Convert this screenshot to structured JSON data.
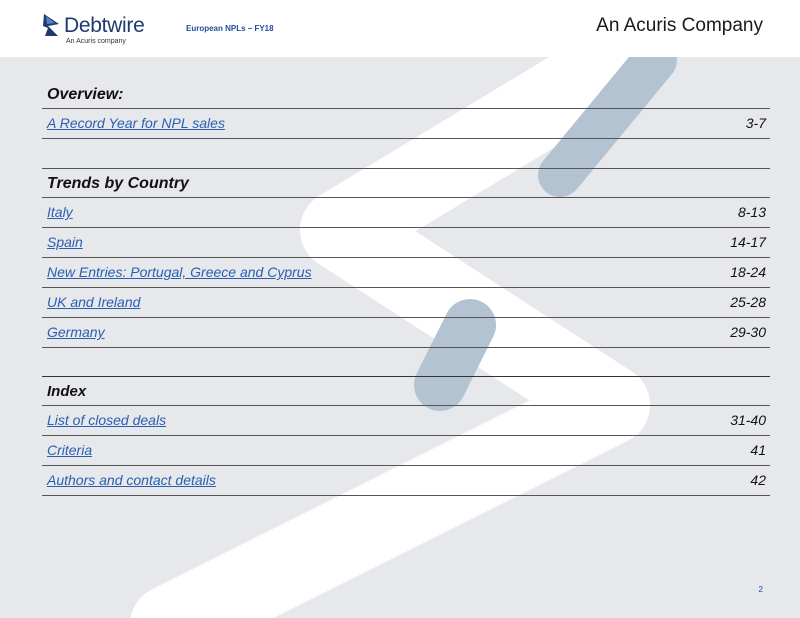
{
  "header": {
    "brand": "Debtwire",
    "brand_sub": "An Acuris company",
    "report_title": "European NPLs – FY18",
    "company": "An Acuris Company"
  },
  "toc": {
    "overview": {
      "heading": "Overview:",
      "items": [
        {
          "label": "A Record Year for NPL sales",
          "pages": "3-7"
        }
      ]
    },
    "trends": {
      "heading": "Trends by Country",
      "items": [
        {
          "label": "Italy",
          "pages": "8-13"
        },
        {
          "label": "Spain",
          "pages": "14-17"
        },
        {
          "label": "New Entries: Portugal, Greece and Cyprus",
          "pages": "18-24"
        },
        {
          "label": "UK and Ireland",
          "pages": "25-28"
        },
        {
          "label": "Germany",
          "pages": "29-30"
        }
      ]
    },
    "index": {
      "heading": "Index",
      "items": [
        {
          "label": "List of closed deals",
          "pages": "31-40"
        },
        {
          "label": "Criteria",
          "pages": "41"
        },
        {
          "label": "Authors and contact details",
          "pages": "42"
        }
      ]
    }
  },
  "page_number": "2",
  "colors": {
    "link": "#2a5fb0",
    "brand": "#1e3a6e",
    "background": "#e6e8ec",
    "accent_stroke": "#b3c3d1"
  }
}
